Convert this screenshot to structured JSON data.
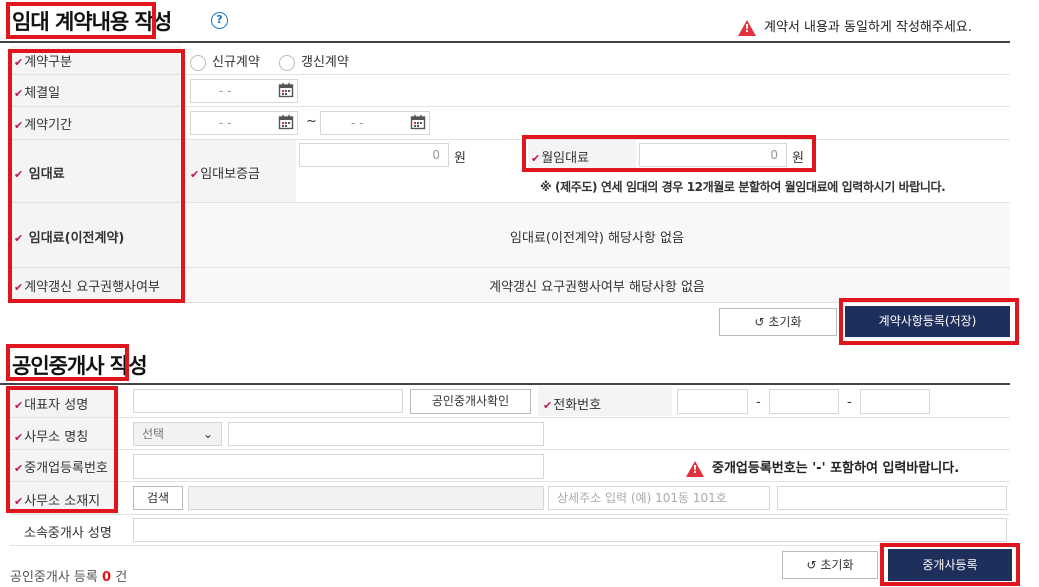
{
  "contract": {
    "title": "임대 계약내용 작성",
    "help_icon": "?",
    "notice": "계약서 내용과 동일하게 작성해주세요.",
    "labels": {
      "type": "계약구분",
      "date": "체결일",
      "period": "계약기간",
      "rent": "임대료",
      "deposit": "임대보증금",
      "monthly": "월임대료",
      "prev": "임대료(이전계약)",
      "renewal": "계약갱신 요구권행사여부"
    },
    "radio_new": "신규계약",
    "radio_renew": "갱신계약",
    "date_value": "-  -",
    "period_from": "-  -",
    "period_tilde": "~",
    "period_to": "-  -",
    "deposit_value": "0",
    "monthly_value": "0",
    "unit": "원",
    "jeju_note": "※ (제주도) 연세 임대의 경우 12개월로 분할하여 월임대료에 입력하시기 바랍니다.",
    "prev_none": "임대료(이전계약) 해당사항 없음",
    "renewal_none": "계약갱신 요구권행사여부 해당사항 없음",
    "reset_button": "초기화",
    "save_button": "계약사항등록(저장)"
  },
  "agent": {
    "title": "공인중개사 작성",
    "labels": {
      "rep": "대표자 성명",
      "office": "사무소 명칭",
      "regno": "중개업등록번호",
      "address": "사무소 소재지",
      "member": "소속중개사 성명",
      "phone": "전화번호"
    },
    "confirm_button": "공인중개사확인",
    "phone_dash": "-",
    "select_value": "선택",
    "regno_notice": "중개업등록번호는 '-' 포함하여 입력바랍니다.",
    "search_button": "검색",
    "detail_placeholder": "상세주소 입력 (예) 101동 101호",
    "count_prefix": "공인중개사 등록",
    "count": "0",
    "count_suffix": "건",
    "reset_button": "초기화",
    "register_button": "중개사등록"
  },
  "colors": {
    "highlight": "#e0161f",
    "navy": "#1f2f5c",
    "required": "#c4174f"
  }
}
